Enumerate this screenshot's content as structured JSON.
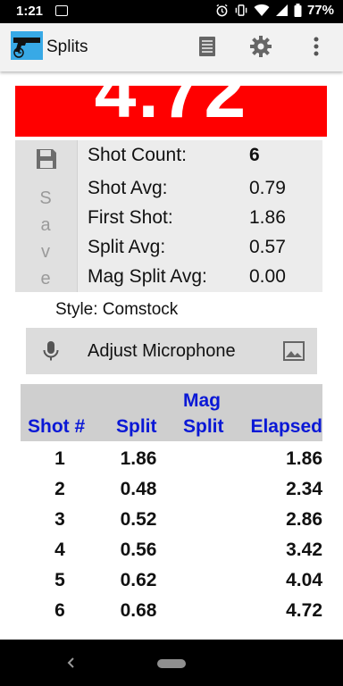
{
  "status_bar": {
    "time": "1:21",
    "battery": "77%"
  },
  "app_bar": {
    "title": "Splits",
    "actions": [
      "list-icon",
      "gear-icon",
      "more-vert-icon"
    ]
  },
  "timer": {
    "display": "4.72",
    "background_color": "#ff0000"
  },
  "save_button": {
    "label": "Save"
  },
  "stats": {
    "shot_count": {
      "label": "Shot Count:",
      "value": "6"
    },
    "shot_avg": {
      "label": "Shot Avg:",
      "value": "0.79"
    },
    "first_shot": {
      "label": "First Shot:",
      "value": "1.86"
    },
    "split_avg": {
      "label": "Split Avg:",
      "value": "0.57"
    },
    "mag_split_avg": {
      "label": "Mag Split Avg:",
      "value": "0.00"
    }
  },
  "style_text": "Style: Comstock",
  "microphone": {
    "label": "Adjust Microphone"
  },
  "table": {
    "headers": {
      "shot": "Shot #",
      "split": "Split",
      "mag_split_line1": "Mag",
      "mag_split_line2": "Split",
      "elapsed": "Elapsed"
    },
    "rows": [
      {
        "shot": "1",
        "split": "1.86",
        "mag_split": "",
        "elapsed": "1.86"
      },
      {
        "shot": "2",
        "split": "0.48",
        "mag_split": "",
        "elapsed": "2.34"
      },
      {
        "shot": "3",
        "split": "0.52",
        "mag_split": "",
        "elapsed": "2.86"
      },
      {
        "shot": "4",
        "split": "0.56",
        "mag_split": "",
        "elapsed": "3.42"
      },
      {
        "shot": "5",
        "split": "0.62",
        "mag_split": "",
        "elapsed": "4.04"
      },
      {
        "shot": "6",
        "split": "0.68",
        "mag_split": "",
        "elapsed": "4.72"
      }
    ],
    "header_color": "#0a18d6"
  }
}
